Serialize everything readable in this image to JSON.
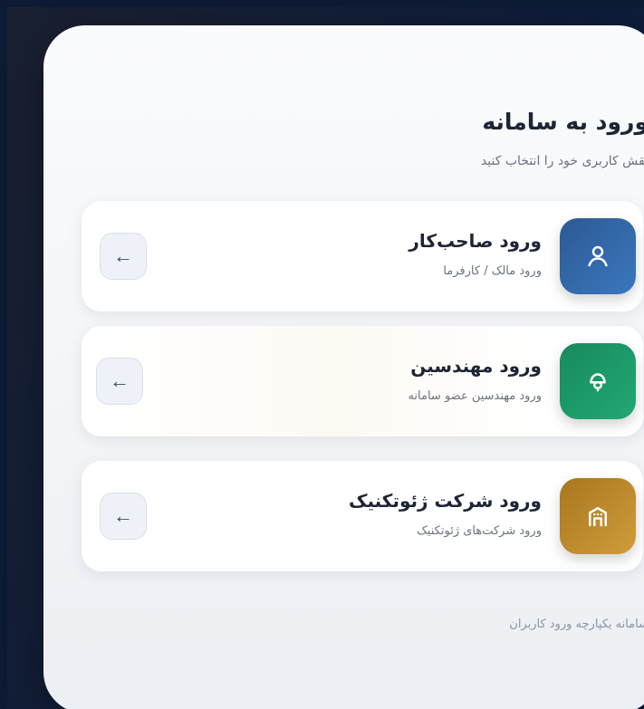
{
  "login": {
    "title": "ورود به سامانه",
    "subtitle": "نقش کاربری خود را انتخاب کنید",
    "footer": "سامانه یکپارچه ورود کاربران"
  },
  "roles": [
    {
      "title": "ورود صاحب‌کار",
      "description": "ورود مالک / کارفرما",
      "icon": "user-icon",
      "color": "#2c5e9e",
      "arrow": "←"
    },
    {
      "title": "ورود مهندسین",
      "description": "ورود مهندسین عضو سامانه",
      "icon": "engineer-icon",
      "color": "#1b8a60",
      "arrow": "←"
    },
    {
      "title": "ورود شرکت ژئوتکنیک",
      "description": "ورود شرکت‌های ژئوتکنیک",
      "icon": "building-icon",
      "color": "#b9862a",
      "arrow": "←"
    }
  ]
}
